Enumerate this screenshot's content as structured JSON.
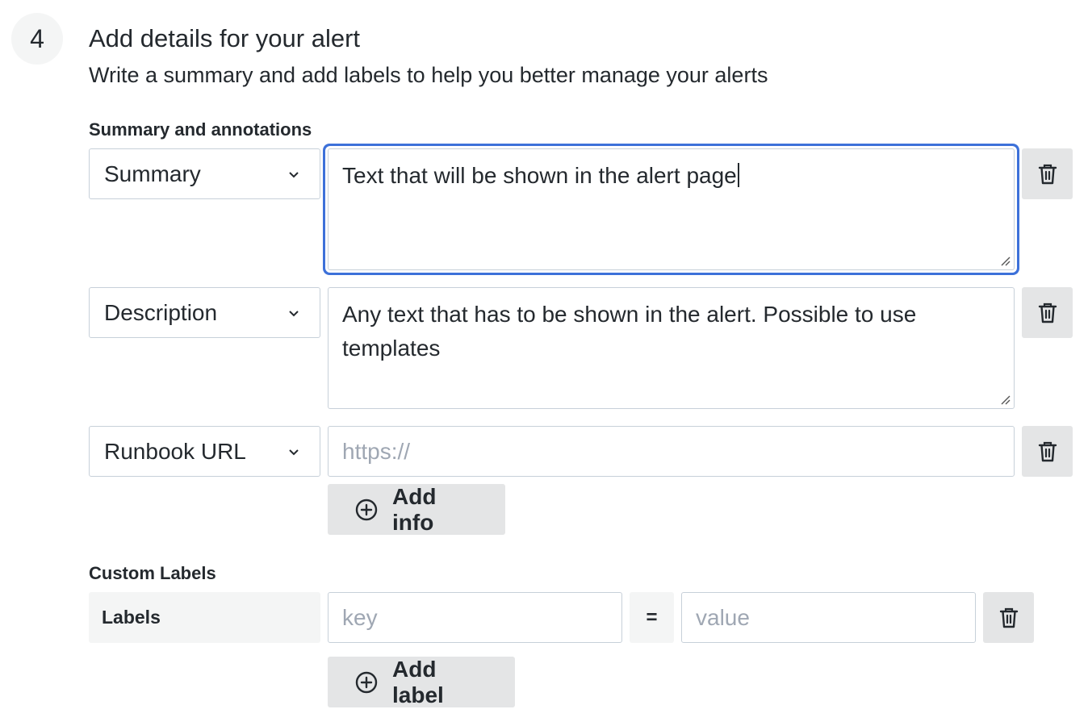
{
  "step": {
    "number": "4",
    "title": "Add details for your alert",
    "subtitle": "Write a summary and add labels to help you better manage your alerts"
  },
  "annotations": {
    "section_label": "Summary and annotations",
    "rows": [
      {
        "select_value": "Summary",
        "text_value": "Text that will be shown in the alert page",
        "focused": true
      },
      {
        "select_value": "Description",
        "text_value": "Any text that has to be shown in the alert. Possible to use templates"
      },
      {
        "select_value": "Runbook URL",
        "placeholder": "https://"
      }
    ],
    "add_button_label": "Add info"
  },
  "custom_labels": {
    "section_label": "Custom Labels",
    "tag": "Labels",
    "key_placeholder": "key",
    "operator": "=",
    "value_placeholder": "value",
    "add_button_label": "Add label"
  },
  "icons": {
    "select_chevron": "chevron-down-icon",
    "delete": "trash-icon",
    "add": "plus-circle-icon",
    "resize": "resize-handle-icon"
  },
  "colors": {
    "focus_ring": "#3d71d9",
    "button_bg": "#e4e5e6",
    "border": "#c7d0d9",
    "muted_bg": "#f4f5f5",
    "placeholder": "#9fa7b3",
    "text": "#24292e"
  }
}
